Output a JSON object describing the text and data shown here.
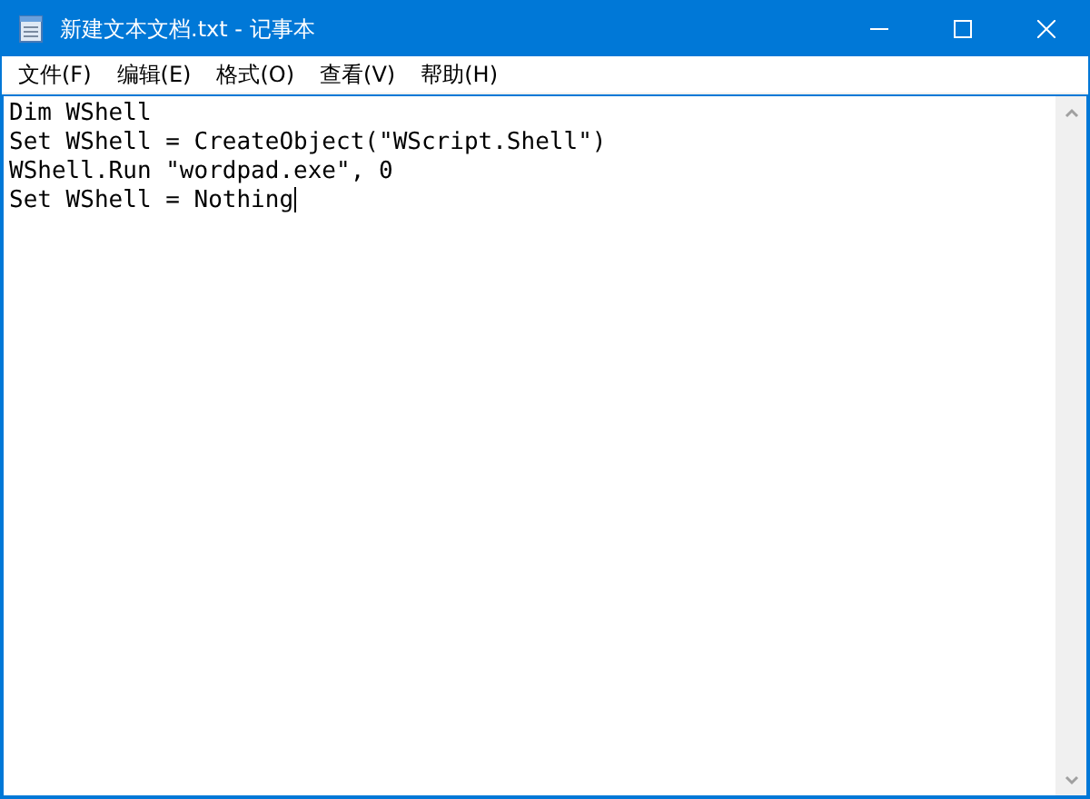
{
  "window": {
    "title": "新建文本文档.txt - 记事本"
  },
  "menu": [
    {
      "label": "文件(F)"
    },
    {
      "label": "编辑(E)"
    },
    {
      "label": "格式(O)"
    },
    {
      "label": "查看(V)"
    },
    {
      "label": "帮助(H)"
    }
  ],
  "editor": {
    "lines": [
      "Dim WShell",
      "Set WShell = CreateObject(\"WScript.Shell\")",
      "WShell.Run \"wordpad.exe\", 0",
      "Set WShell = Nothing"
    ]
  }
}
